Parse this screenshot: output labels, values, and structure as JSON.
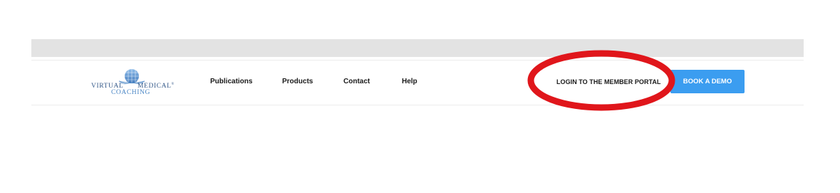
{
  "logo": {
    "word_left": "VIRTUAL",
    "word_right": "MEDICAL",
    "word_bottom": "COACHING",
    "trademark": "®"
  },
  "nav": {
    "items": [
      {
        "label": "Publications"
      },
      {
        "label": "Products"
      },
      {
        "label": "Contact"
      },
      {
        "label": "Help"
      }
    ],
    "login_label": "LOGIN TO THE MEMBER PORTAL",
    "demo_label": "BOOK A DEMO"
  },
  "colors": {
    "top_bar": "#e3e3e3",
    "demo_button": "#3b9df0",
    "annotation_circle": "#e0161b",
    "logo_dark": "#365a8a",
    "logo_light": "#4a86c5"
  }
}
